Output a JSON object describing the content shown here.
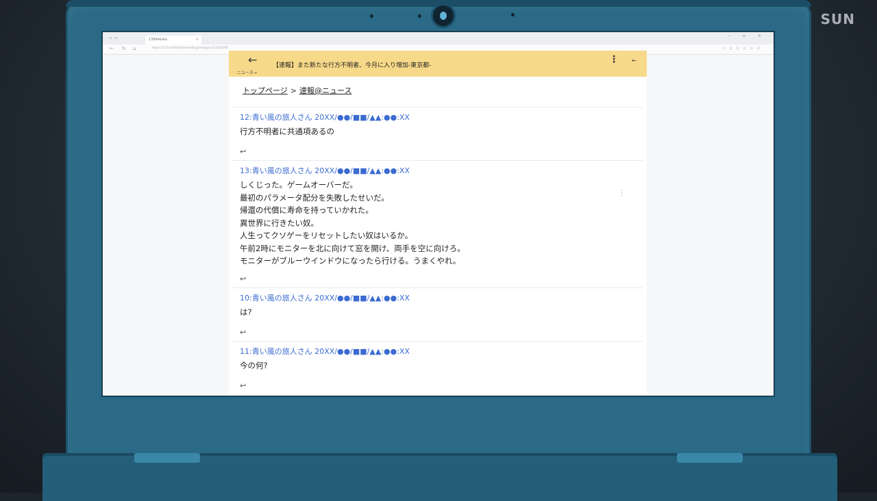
{
  "watermark": "SUN",
  "browser": {
    "tab_title": "13864&A&",
    "tab_close": "×",
    "url": "https://13d.net/sokh/ervedt.g/newsplus/13518/f0",
    "window_controls": "– ▫ ×"
  },
  "page": {
    "back_arrow": "←",
    "back_label": "ニュース→",
    "title": "【速報】また新たな行方不明者、今月に入り増加-東京都-",
    "more": "⋮",
    "small_arrow": "←",
    "breadcrumb": {
      "home": "トップページ",
      "separator": ">",
      "current": "速報@ニュース"
    },
    "posts": [
      {
        "header": "12:青い風の旅人さん 20XX/●●/■■/▲▲:●●:XX",
        "lines": [
          "行方不明者に共通項あるの"
        ]
      },
      {
        "header": "13:青い風の旅人さん 20XX/●●/■■/▲▲:●●:XX",
        "lines": [
          "しくじった。ゲームオーバーだ。",
          "最初のパラメータ配分を失敗したせいだ。",
          "帰還の代償に寿命を持っていかれた。",
          "異世界に行きたい奴。",
          "人生ってクソゲーをリセットしたい奴はいるか。",
          "午前2時にモニターを北に向けて窓を開け、両手を空に向けろ。",
          "モニターがブルーウインドウになったら行ける。うまくやれ。"
        ]
      },
      {
        "header": "10:青い風の旅人さん 20XX/●●/■■/▲▲:●●:XX",
        "lines": [
          "は?"
        ]
      },
      {
        "header": "11:青い風の旅人さん 20XX/●●/■■/▲▲:●●:XX",
        "lines": [
          "今の何?"
        ]
      }
    ],
    "reply_icon": "↩"
  }
}
